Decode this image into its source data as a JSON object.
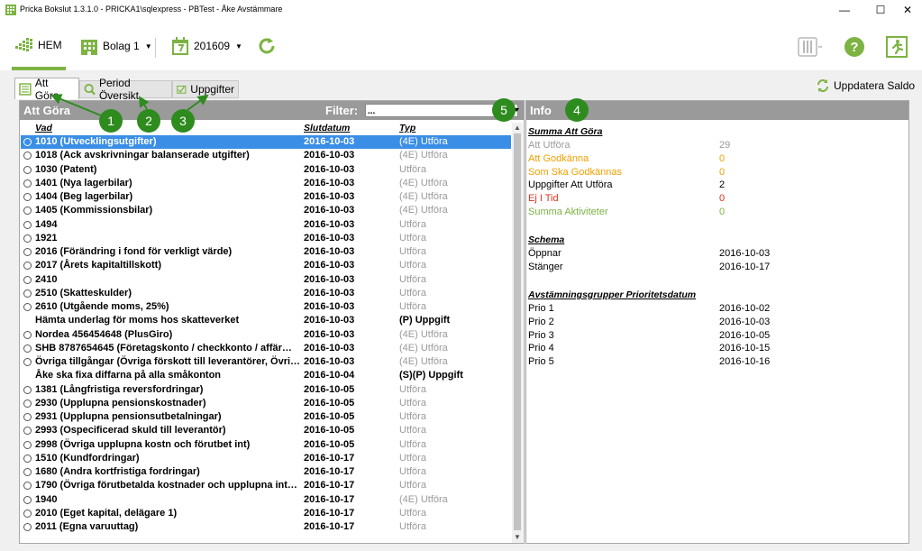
{
  "window": {
    "title": "Pricka Bokslut 1.3.1.0 - PRICKA1\\sqlexpress - PBTest - Åke Avstämmare",
    "minimize": "—",
    "maximize": "☐",
    "close": "✕"
  },
  "toolbar": {
    "home_label": "HEM",
    "company_label": "Bolag 1",
    "period_label": "201609",
    "accent": "#7cb342"
  },
  "tabs": [
    {
      "label": "Att Göra"
    },
    {
      "label": "Period Översikt"
    },
    {
      "label": "Uppgifter"
    }
  ],
  "update_saldo_label": "Uppdatera Saldo",
  "left": {
    "header": "Att Göra",
    "filter_label": "Filter:",
    "filter_value": "...",
    "columns": [
      "Vad",
      "Slutdatum",
      "Typ"
    ],
    "rows": [
      {
        "vad": "1010 (Utvecklingsutgifter)",
        "date": "2016-10-03",
        "typ": "(4E)  Utföra",
        "icon": true,
        "selected": true
      },
      {
        "vad": "1018 (Ack avskrivningar balanserade utgifter)",
        "date": "2016-10-03",
        "typ": "(4E)  Utföra",
        "icon": true
      },
      {
        "vad": "1030 (Patent)",
        "date": "2016-10-03",
        "typ": "Utföra",
        "icon": true
      },
      {
        "vad": "1401 (Nya lagerbilar)",
        "date": "2016-10-03",
        "typ": "(4E)  Utföra",
        "icon": true
      },
      {
        "vad": "1404 (Beg lagerbilar)",
        "date": "2016-10-03",
        "typ": "(4E)  Utföra",
        "icon": true
      },
      {
        "vad": "1405 (Kommissionsbilar)",
        "date": "2016-10-03",
        "typ": "(4E)  Utföra",
        "icon": true
      },
      {
        "vad": "1494",
        "date": "2016-10-03",
        "typ": "Utföra",
        "icon": true
      },
      {
        "vad": "1921",
        "date": "2016-10-03",
        "typ": "Utföra",
        "icon": true
      },
      {
        "vad": "2016 (Förändring i fond för verkligt värde)",
        "date": "2016-10-03",
        "typ": "Utföra",
        "icon": true
      },
      {
        "vad": "2017 (Årets kapitaltillskott)",
        "date": "2016-10-03",
        "typ": "Utföra",
        "icon": true
      },
      {
        "vad": "2410",
        "date": "2016-10-03",
        "typ": "Utföra",
        "icon": true
      },
      {
        "vad": "2510 (Skatteskulder)",
        "date": "2016-10-03",
        "typ": "Utföra",
        "icon": true
      },
      {
        "vad": "2610 (Utgående moms, 25%)",
        "date": "2016-10-03",
        "typ": "Utföra",
        "icon": true
      },
      {
        "vad": "Hämta underlag för moms hos skatteverket",
        "date": "2016-10-03",
        "typ": "(P) Uppgift",
        "icon": false,
        "typ_bold": true
      },
      {
        "vad": "Nordea 456454648 (PlusGiro)",
        "date": "2016-10-03",
        "typ": "(4E)  Utföra",
        "icon": true
      },
      {
        "vad": "SHB 8787654645 (Företagskonto / checkkonto / affär…",
        "date": "2016-10-03",
        "typ": "(4E)  Utföra",
        "icon": true
      },
      {
        "vad": "Övriga tillgångar (Övriga förskott till leverantörer, Övri…",
        "date": "2016-10-03",
        "typ": "(4E)  Utföra",
        "icon": true
      },
      {
        "vad": "Åke ska fixa diffarna på alla småkonton",
        "date": "2016-10-04",
        "typ": "(S)(P) Uppgift",
        "icon": false,
        "typ_bold": true
      },
      {
        "vad": "1381 (Långfristiga reversfordringar)",
        "date": "2016-10-05",
        "typ": "Utföra",
        "icon": true
      },
      {
        "vad": "2930 (Upplupna pensionskostnader)",
        "date": "2016-10-05",
        "typ": "Utföra",
        "icon": true
      },
      {
        "vad": "2931 (Upplupna pensionsutbetalningar)",
        "date": "2016-10-05",
        "typ": "Utföra",
        "icon": true
      },
      {
        "vad": "2993 (Ospecificerad skuld till leverantör)",
        "date": "2016-10-05",
        "typ": "Utföra",
        "icon": true
      },
      {
        "vad": "2998 (Övriga upplupna kostn och förutbet int)",
        "date": "2016-10-05",
        "typ": "Utföra",
        "icon": true
      },
      {
        "vad": "1510 (Kundfordringar)",
        "date": "2016-10-17",
        "typ": "Utföra",
        "icon": true
      },
      {
        "vad": "1680 (Andra kortfristiga fordringar)",
        "date": "2016-10-17",
        "typ": "Utföra",
        "icon": true
      },
      {
        "vad": "1790 (Övriga förutbetalda kostnader och upplupna int…",
        "date": "2016-10-17",
        "typ": "Utföra",
        "icon": true
      },
      {
        "vad": "1940",
        "date": "2016-10-17",
        "typ": "(4E)  Utföra",
        "icon": true
      },
      {
        "vad": "2010 (Eget kapital, delägare 1)",
        "date": "2016-10-17",
        "typ": "Utföra",
        "icon": true
      },
      {
        "vad": "2011 (Egna varuuttag)",
        "date": "2016-10-17",
        "typ": "Utföra",
        "icon": true
      }
    ]
  },
  "right": {
    "header": "Info",
    "summary_title": "Summa Att Göra",
    "summary": [
      {
        "label": "Att Utföra",
        "value": "29",
        "color": "#9a9a9a",
        "bold": false
      },
      {
        "label": "Att Godkänna",
        "value": "0",
        "color": "#f0a000",
        "bold": false
      },
      {
        "label": "Som Ska Godkännas",
        "value": "0",
        "color": "#f0a000",
        "bold": false
      },
      {
        "label": "Uppgifter Att Utföra",
        "value": "2",
        "color": "#000000",
        "bold": false
      },
      {
        "label": "Ej I Tid",
        "value": "0",
        "color": "#e0301e",
        "bold": false
      },
      {
        "label": "Summa Aktiviteter",
        "value": "0",
        "color": "#7cb342",
        "bold": false
      }
    ],
    "schema_title": "Schema",
    "schema": [
      {
        "label": "Öppnar",
        "value": "2016-10-03"
      },
      {
        "label": "Stänger",
        "value": "2016-10-17"
      }
    ],
    "prio_title": "Avstämningsgrupper Prioritetsdatum",
    "prio": [
      {
        "label": "Prio 1",
        "value": "2016-10-02"
      },
      {
        "label": "Prio 2",
        "value": "2016-10-03"
      },
      {
        "label": "Prio 3",
        "value": "2016-10-05"
      },
      {
        "label": "Prio 4",
        "value": "2016-10-15"
      },
      {
        "label": "Prio 5",
        "value": "2016-10-16"
      }
    ]
  },
  "callouts": [
    "1",
    "2",
    "3",
    "4",
    "5"
  ]
}
